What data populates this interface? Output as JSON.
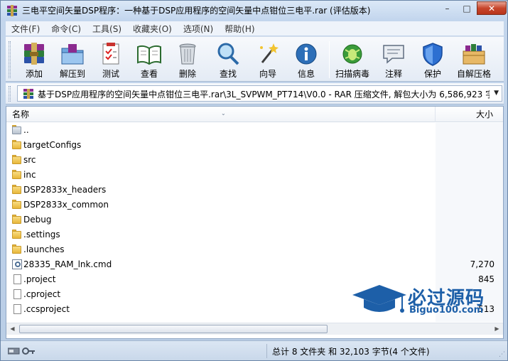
{
  "window": {
    "title": "三电平空间矢量DSP程序：一种基于DSP应用程序的空间矢量中点钳位三电平.rar (评估版本)",
    "minimize_glyph": "–",
    "maximize_glyph": "□",
    "close_glyph": "✕"
  },
  "menu": {
    "items": [
      "文件(F)",
      "命令(C)",
      "工具(S)",
      "收藏夹(O)",
      "选项(N)",
      "帮助(H)"
    ]
  },
  "toolbar": {
    "buttons": [
      {
        "label": "添加",
        "icon": "add-archive-icon"
      },
      {
        "label": "解压到",
        "icon": "extract-to-icon"
      },
      {
        "label": "测试",
        "icon": "test-icon"
      },
      {
        "label": "查看",
        "icon": "view-icon"
      },
      {
        "label": "删除",
        "icon": "delete-icon"
      },
      {
        "label": "查找",
        "icon": "find-icon"
      },
      {
        "label": "向导",
        "icon": "wizard-icon"
      },
      {
        "label": "信息",
        "icon": "info-icon"
      },
      {
        "label": "扫描病毒",
        "icon": "virus-scan-icon"
      },
      {
        "label": "注释",
        "icon": "comment-icon"
      },
      {
        "label": "保护",
        "icon": "protect-icon"
      },
      {
        "label": "自解压格",
        "icon": "sfx-icon"
      }
    ]
  },
  "address": {
    "path": "基于DSP应用程序的空间矢量中点钳位三电平.rar\\3L_SVPWM_PT714\\V0.0 - RAR 压缩文件, 解包大小为 6,586,923 字节"
  },
  "list": {
    "headers": {
      "name": "名称",
      "size": "大小"
    },
    "rows": [
      {
        "name": "..",
        "size": "",
        "type": "folder"
      },
      {
        "name": "targetConfigs",
        "size": "",
        "type": "folder"
      },
      {
        "name": "src",
        "size": "",
        "type": "folder"
      },
      {
        "name": "inc",
        "size": "",
        "type": "folder"
      },
      {
        "name": "DSP2833x_headers",
        "size": "",
        "type": "folder"
      },
      {
        "name": "DSP2833x_common",
        "size": "",
        "type": "folder"
      },
      {
        "name": "Debug",
        "size": "",
        "type": "folder"
      },
      {
        "name": ".settings",
        "size": "",
        "type": "folder"
      },
      {
        "name": ".launches",
        "size": "",
        "type": "folder"
      },
      {
        "name": "28335_RAM_lnk.cmd",
        "size": "7,270",
        "type": "cmd"
      },
      {
        "name": ".project",
        "size": "845",
        "type": "file"
      },
      {
        "name": ".cproject",
        "size": "",
        "type": "file"
      },
      {
        "name": ".ccsproject",
        "size": "513",
        "type": "file"
      }
    ]
  },
  "watermark": {
    "title": "必过源码",
    "subtitle": "Biguo100.com"
  },
  "status": {
    "summary": "总计 8 文件夹 和 32,103 字节(4 个文件)"
  },
  "colors": {
    "accent": "#1d5fa8",
    "close_button": "#c7462c"
  }
}
